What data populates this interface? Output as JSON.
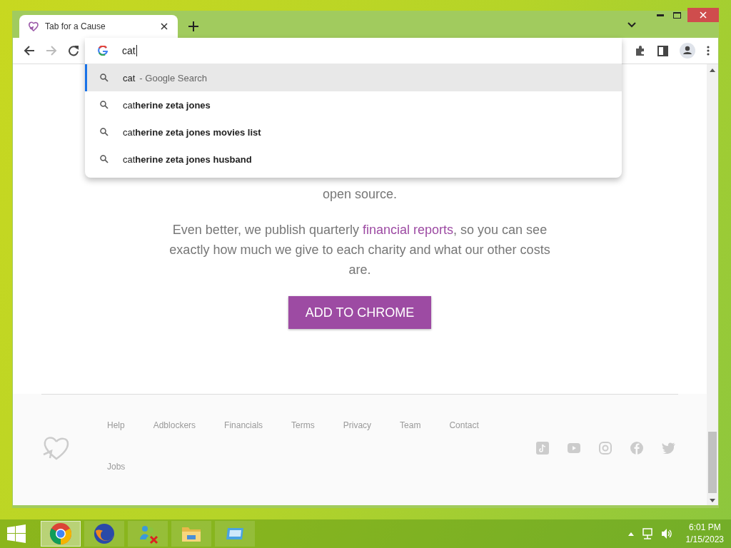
{
  "tabs": [
    {
      "title": "Tab for a Cause",
      "selected": true
    }
  ],
  "omnibox": {
    "value": "cat"
  },
  "suggestions": [
    {
      "text": "cat",
      "suffix": "- Google Search",
      "selected": true
    },
    {
      "text": "cat**herine zeta jones**",
      "selected": false
    },
    {
      "text": "cat**herine zeta jones movies list**",
      "selected": false
    },
    {
      "text": "cat**herine zeta jones husband**",
      "selected": false
    }
  ],
  "paragraphs": [
    [
      {
        "text": "open source."
      }
    ],
    [
      {
        "text": "Even better, we publish quarterly "
      },
      {
        "text": "financial reports",
        "link": true
      },
      {
        "text": ", so you can see exactly how much we give to each charity and what our other costs are."
      }
    ]
  ],
  "cta": "ADD TO CHROME",
  "footer": {
    "links": [
      "Help",
      "Adblockers",
      "Financials",
      "Terms",
      "Privacy",
      "Team",
      "Contact",
      "Jobs"
    ],
    "social": [
      {
        "kind": "tiktok"
      },
      {
        "kind": "youtube"
      },
      {
        "kind": "instagram"
      },
      {
        "kind": "facebook"
      },
      {
        "kind": "twitter"
      }
    ]
  },
  "taskbar": {
    "apps": [
      {
        "kind": "chrome",
        "selected": true
      },
      {
        "kind": "firefox",
        "selected": false
      },
      {
        "kind": "messenger",
        "selected": false
      },
      {
        "kind": "explorer",
        "selected": false
      },
      {
        "kind": "window",
        "selected": false
      }
    ],
    "time": "6:01 PM",
    "date": "1/15/2023"
  }
}
